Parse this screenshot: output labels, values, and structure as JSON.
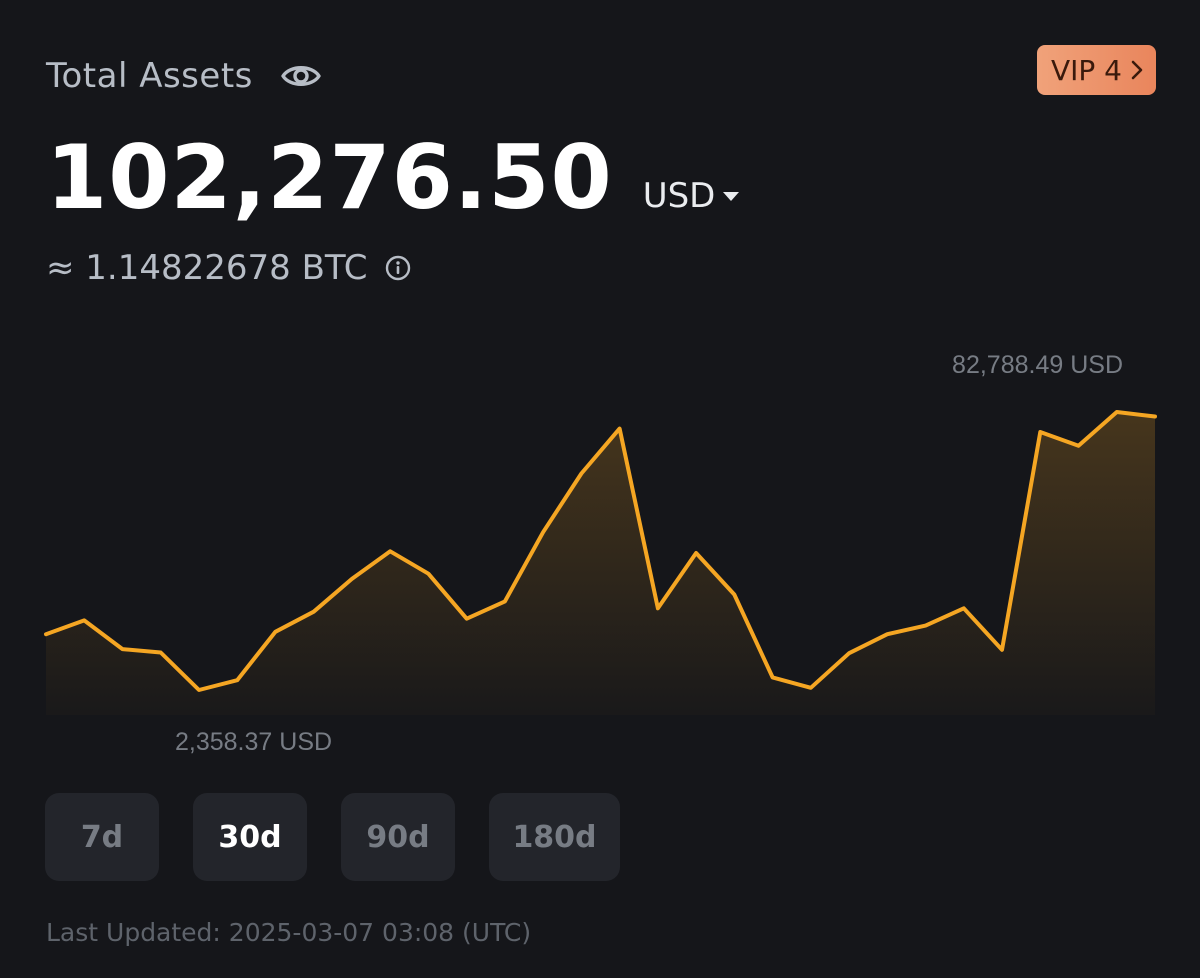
{
  "header": {
    "title": "Total Assets",
    "vip_label": "VIP 4"
  },
  "balance": {
    "value": "102,276.50",
    "currency": "USD",
    "btc_equivalent": "≈ 1.14822678 BTC"
  },
  "colors": {
    "accent_line": "#f5a623",
    "vip_badge": "#ee956a",
    "background": "#15161a"
  },
  "icons": {
    "visibility": "eye-icon",
    "vip_arrow": "chevron-right-icon",
    "currency_dropdown": "caret-down-icon",
    "info": "info-icon"
  },
  "chart_data": {
    "type": "area",
    "max_label": "82,788.49 USD",
    "min_label": "2,358.37 USD",
    "max_value": 82788.49,
    "min_value": 2358.37,
    "values": [
      18500,
      22500,
      14200,
      13200,
      2358.37,
      5200,
      19200,
      25000,
      34500,
      42500,
      36000,
      23000,
      28000,
      48000,
      65000,
      78000,
      26000,
      42000,
      30000,
      6000,
      3000,
      13000,
      18500,
      21000,
      26000,
      14000,
      77000,
      73000,
      82788.49,
      81500
    ],
    "grid": false
  },
  "range_tabs": [
    {
      "label": "7d",
      "active": false
    },
    {
      "label": "30d",
      "active": true
    },
    {
      "label": "90d",
      "active": false
    },
    {
      "label": "180d",
      "active": false
    }
  ],
  "footer": {
    "last_updated": "Last Updated: 2025-03-07 03:08 (UTC)"
  }
}
